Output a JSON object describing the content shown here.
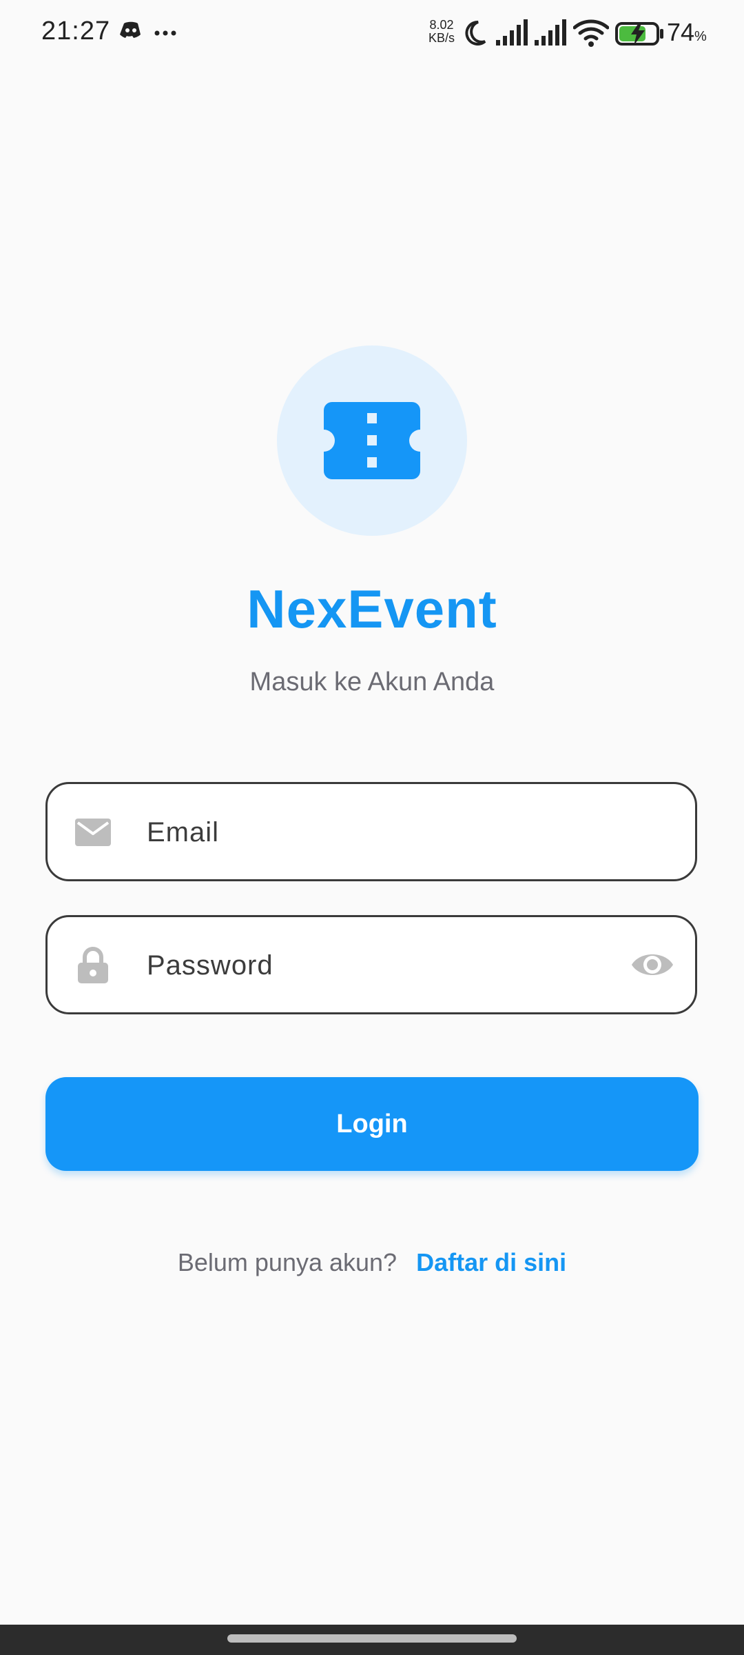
{
  "status_bar": {
    "time": "21:27",
    "network_speed_value": "8.02",
    "network_speed_unit": "KB/s",
    "battery_level": "74",
    "battery_unit": "%",
    "icons": [
      "discord-icon",
      "more-dots-icon",
      "moon-icon",
      "signal-icon",
      "signal-icon",
      "wifi-icon",
      "battery-charging-icon"
    ]
  },
  "app": {
    "title": "NexEvent",
    "subtitle": "Masuk ke Akun Anda",
    "logo_icon": "ticket-icon",
    "accent_color": "#1596f3"
  },
  "form": {
    "email": {
      "placeholder": "Email",
      "value": "",
      "icon": "mail-icon"
    },
    "password": {
      "placeholder": "Password",
      "value": "",
      "icon": "lock-icon",
      "toggle_icon": "eye-icon"
    },
    "login_label": "Login"
  },
  "register": {
    "prompt": "Belum punya akun?",
    "link_label": "Daftar di sini"
  }
}
